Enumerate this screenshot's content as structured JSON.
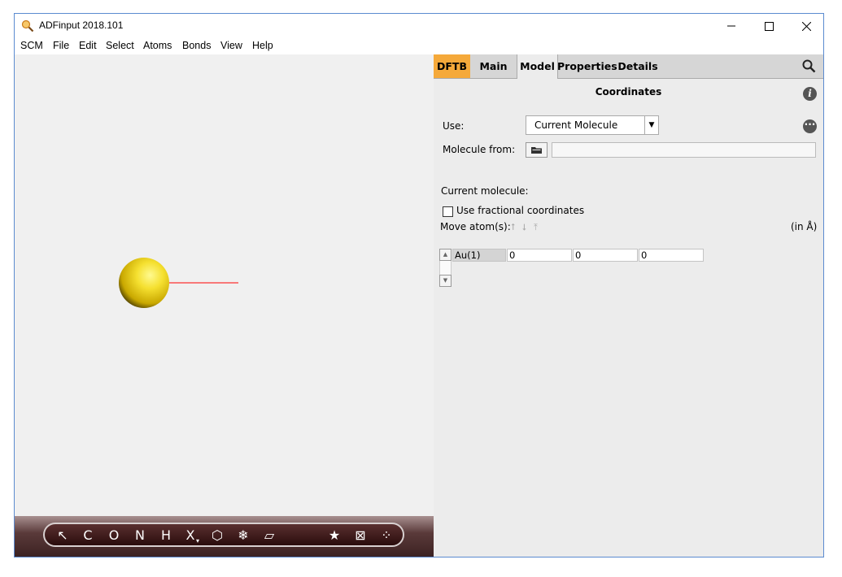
{
  "window": {
    "title": "ADFinput 2018.101"
  },
  "menu": [
    "SCM",
    "File",
    "Edit",
    "Select",
    "Atoms",
    "Bonds",
    "View",
    "Help"
  ],
  "toolbar": {
    "items": [
      {
        "name": "select-arrow-tool",
        "glyph": "↖"
      },
      {
        "name": "carbon-atom-tool",
        "glyph": "C"
      },
      {
        "name": "oxygen-atom-tool",
        "glyph": "O"
      },
      {
        "name": "nitrogen-atom-tool",
        "glyph": "N"
      },
      {
        "name": "hydrogen-atom-tool",
        "glyph": "H"
      },
      {
        "name": "other-element-tool",
        "glyph": "X"
      },
      {
        "name": "ring-tool",
        "glyph": "⬡"
      },
      {
        "name": "crystal-tool",
        "glyph": "❄"
      },
      {
        "name": "slab-tool",
        "glyph": "▱"
      },
      {
        "name": "favorite-tool",
        "glyph": "★"
      },
      {
        "name": "box-tool",
        "glyph": "⊠"
      },
      {
        "name": "cluster-tool",
        "glyph": "⁘"
      }
    ]
  },
  "tabs": {
    "dftb": "DFTB",
    "main": "Main",
    "model": "Model",
    "properties": "Properties",
    "details": "Details"
  },
  "panel": {
    "section_title": "Coordinates",
    "use_label": "Use:",
    "use_value": "Current Molecule",
    "molecule_from_label": "Molecule from:",
    "molecule_from_value": "",
    "current_molecule_label": "Current molecule:",
    "fractional_label": "Use fractional coordinates",
    "fractional_checked": false,
    "move_atoms_label": "Move atom(s):",
    "units_label": "(in Å)",
    "atoms": [
      {
        "atom": "Au(1)",
        "x": "0",
        "y": "0",
        "z": "0"
      }
    ]
  },
  "colors": {
    "dftb_tab": "#f5a93a",
    "atom_gold": "#f5e030",
    "axis_line": "#ff0000"
  }
}
